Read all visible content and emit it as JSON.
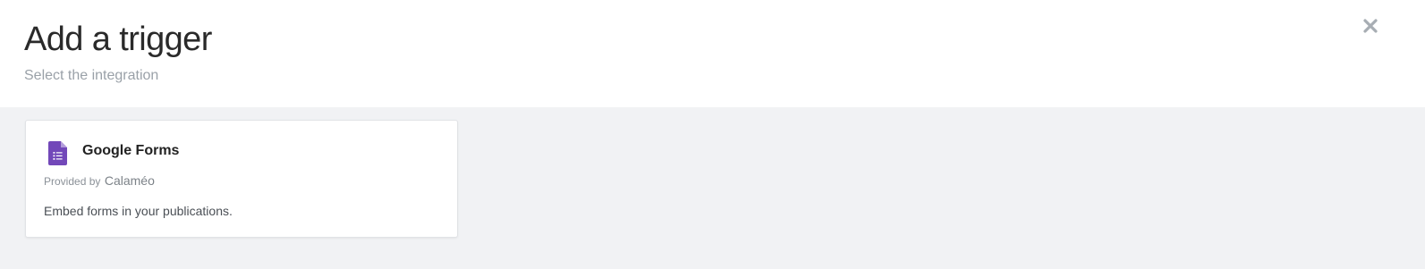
{
  "dialog": {
    "title": "Add a trigger",
    "subtitle": "Select the integration",
    "close_icon": "close-icon"
  },
  "integrations": [
    {
      "name": "Google Forms",
      "icon": "google-forms-icon",
      "provided_by_label": "Provided by",
      "provider": "Calaméo",
      "description": "Embed forms in your publications."
    }
  ],
  "colors": {
    "header_bg": "#ffffff",
    "body_bg": "#f1f2f4",
    "forms_purple": "#7248b9",
    "close_gray": "#a7adb3"
  }
}
